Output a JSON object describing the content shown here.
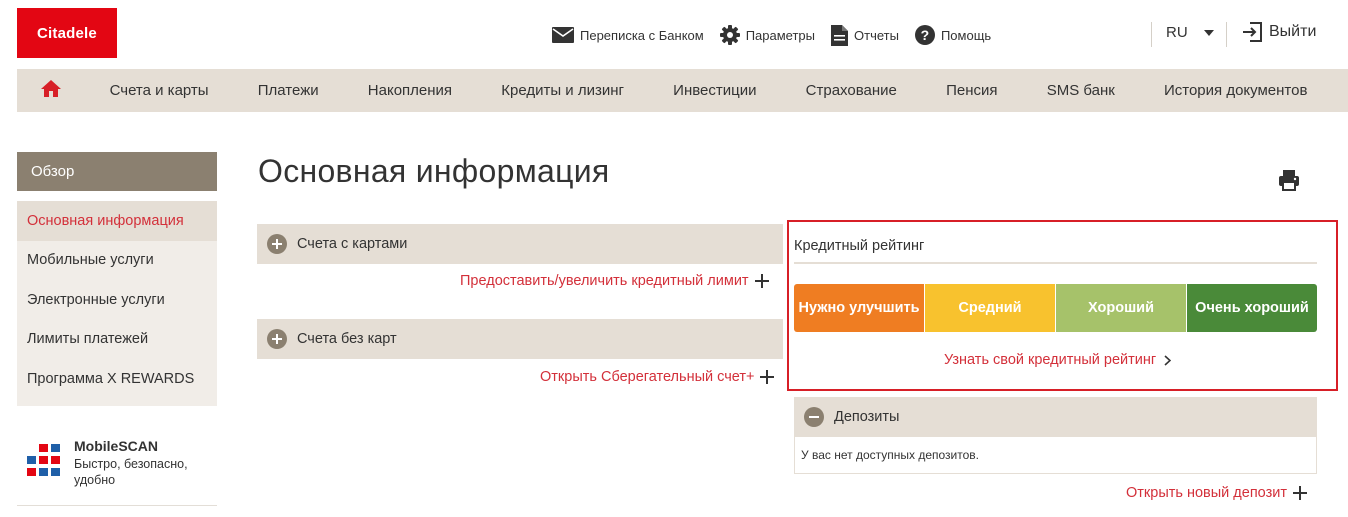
{
  "brand": {
    "logo_text": "Citadele",
    "accent": "#e30613",
    "link_color": "#d3303a"
  },
  "header": {
    "links": [
      {
        "label": "Переписка с Банком",
        "icon": "envelope-icon"
      },
      {
        "label": "Параметры",
        "icon": "gear-icon"
      },
      {
        "label": "Отчеты",
        "icon": "document-icon"
      },
      {
        "label": "Помощь",
        "icon": "help-icon"
      }
    ],
    "language": "RU",
    "logout_label": "Выйти"
  },
  "nav": {
    "home_icon": "home-icon",
    "items": [
      "Счета и карты",
      "Платежи",
      "Накопления",
      "Кредиты и лизинг",
      "Инвестиции",
      "Страхование",
      "Пенсия",
      "SMS банк",
      "История документов"
    ]
  },
  "sidebar": {
    "header": "Обзор",
    "items": [
      {
        "label": "Основная информация",
        "active": true
      },
      {
        "label": "Мобильные услуги",
        "active": false
      },
      {
        "label": "Электронные услуги",
        "active": false
      },
      {
        "label": "Лимиты платежей",
        "active": false
      },
      {
        "label": "Программа X REWARDS",
        "active": false
      }
    ],
    "mobilescan": {
      "title": "MobileSCAN",
      "subtitle": "Быстро, безопасно, удобно"
    }
  },
  "main": {
    "title": "Основная информация",
    "accounts_with_cards": {
      "label": "Счета с картами",
      "link": "Предоставить/увеличить кредитный лимит"
    },
    "accounts_without_cards": {
      "label": "Счета без карт",
      "link": "Открыть Сберегательный счет+"
    }
  },
  "credit_rating": {
    "title": "Кредитный рейтинг",
    "levels": [
      {
        "label": "Нужно улучшить",
        "color": "#ef7d22"
      },
      {
        "label": "Средний",
        "color": "#f8c22e"
      },
      {
        "label": "Хороший",
        "color": "#a6c26a"
      },
      {
        "label": "Очень хороший",
        "color": "#4a8a39"
      }
    ],
    "link": "Узнать свой кредитный рейтинг"
  },
  "deposits": {
    "label": "Депозиты",
    "empty_text": "У вас нет доступных депозитов.",
    "link": "Открыть новый депозит"
  }
}
